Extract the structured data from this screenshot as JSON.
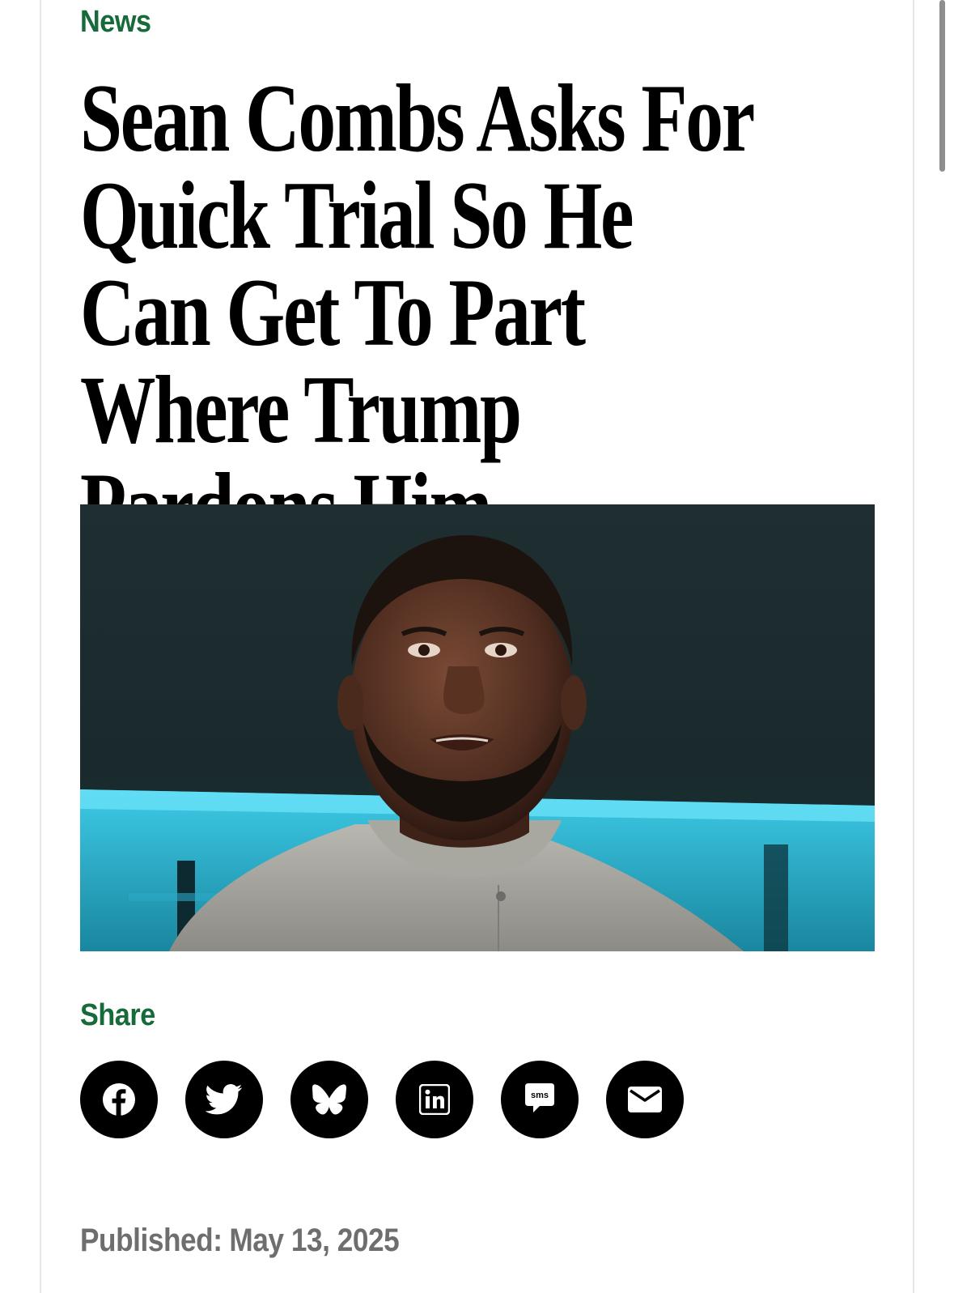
{
  "article": {
    "category": "News",
    "headline": "Sean Combs Asks For Quick Trial So He Can Get To Part Where Trump Pardons Him",
    "share_label": "Share",
    "published_label": "Published:",
    "published_date": "May 13, 2025"
  },
  "share_buttons": [
    {
      "name": "facebook",
      "icon": "facebook-icon"
    },
    {
      "name": "twitter",
      "icon": "twitter-icon"
    },
    {
      "name": "bluesky",
      "icon": "bluesky-icon"
    },
    {
      "name": "linkedin",
      "icon": "linkedin-icon"
    },
    {
      "name": "sms",
      "icon": "sms-icon",
      "icon_text": "sms"
    },
    {
      "name": "email",
      "icon": "email-icon"
    }
  ],
  "colors": {
    "accent_green": "#176a3a",
    "text_black": "#000000",
    "meta_gray": "#6e6e6e",
    "share_button_bg": "#000000"
  }
}
